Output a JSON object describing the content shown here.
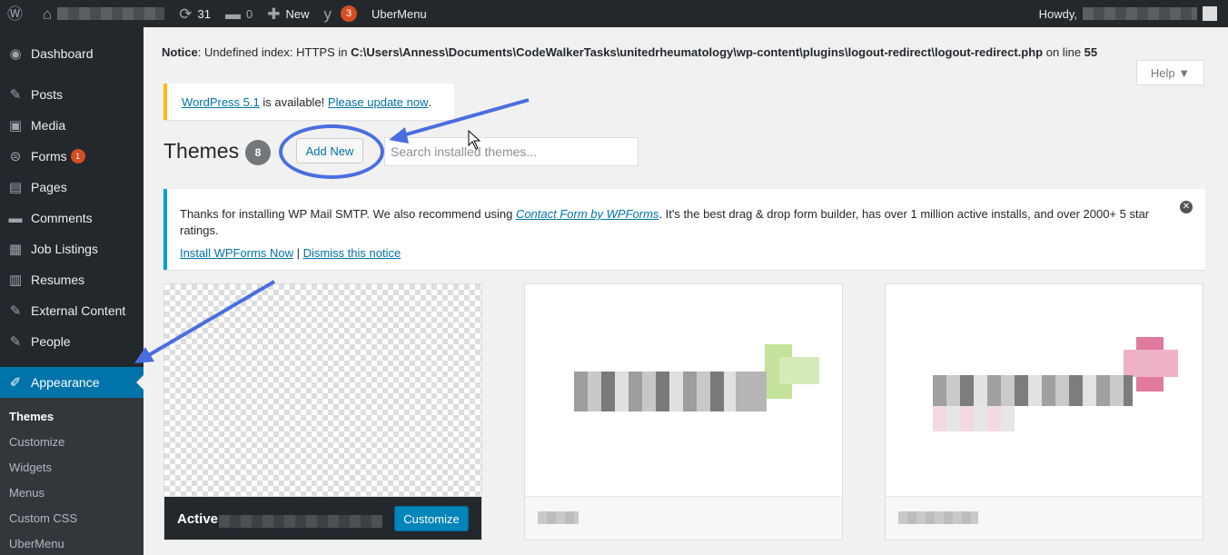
{
  "adminbar": {
    "updates_count": "31",
    "comments_count": "0",
    "new_label": "New",
    "seo_badge": "3",
    "ubermenu_label": "UberMenu",
    "howdy_label": "Howdy,"
  },
  "sidebar": {
    "items": [
      {
        "label": "Dashboard",
        "icon": "dashboard-icon"
      },
      {
        "label": "Posts",
        "icon": "pin-icon"
      },
      {
        "label": "Media",
        "icon": "media-icon"
      },
      {
        "label": "Forms",
        "icon": "forms-icon",
        "badge": "1"
      },
      {
        "label": "Pages",
        "icon": "pages-icon"
      },
      {
        "label": "Comments",
        "icon": "comment-icon"
      },
      {
        "label": "Job Listings",
        "icon": "briefcase-icon"
      },
      {
        "label": "Resumes",
        "icon": "document-icon"
      },
      {
        "label": "External Content",
        "icon": "pin-icon"
      },
      {
        "label": "People",
        "icon": "pin-icon"
      },
      {
        "label": "Appearance",
        "icon": "brush-icon"
      }
    ],
    "submenu": [
      "Themes",
      "Customize",
      "Widgets",
      "Menus",
      "Custom CSS",
      "UberMenu"
    ]
  },
  "notice_php": {
    "prefix": "Notice",
    "message": ": Undefined index: HTTPS in ",
    "path": "C:\\Users\\Anness\\Documents\\CodeWalkerTasks\\unitedrheumatology\\wp-content\\plugins\\logout-redirect\\logout-redirect.php",
    "line_text": " on line ",
    "line": "55"
  },
  "help_label": "Help ▼",
  "update_nag": {
    "link1": "WordPress 5.1",
    "middle": " is available! ",
    "link2": "Please update now",
    "end": "."
  },
  "themes": {
    "title": "Themes",
    "count": "8",
    "add_new": "Add New",
    "search_placeholder": "Search installed themes..."
  },
  "smtp_notice": {
    "text1": "Thanks for installing WP Mail SMTP. We also recommend using ",
    "link": "Contact Form by WPForms",
    "text2": ". It's the best drag & drop form builder, has over 1 million active installs, and over 2000+ 5 star ratings.",
    "install": "Install WPForms Now",
    "sep": " | ",
    "dismiss": "Dismiss this notice"
  },
  "active_theme": {
    "label": "Active:",
    "customize": "Customize"
  }
}
